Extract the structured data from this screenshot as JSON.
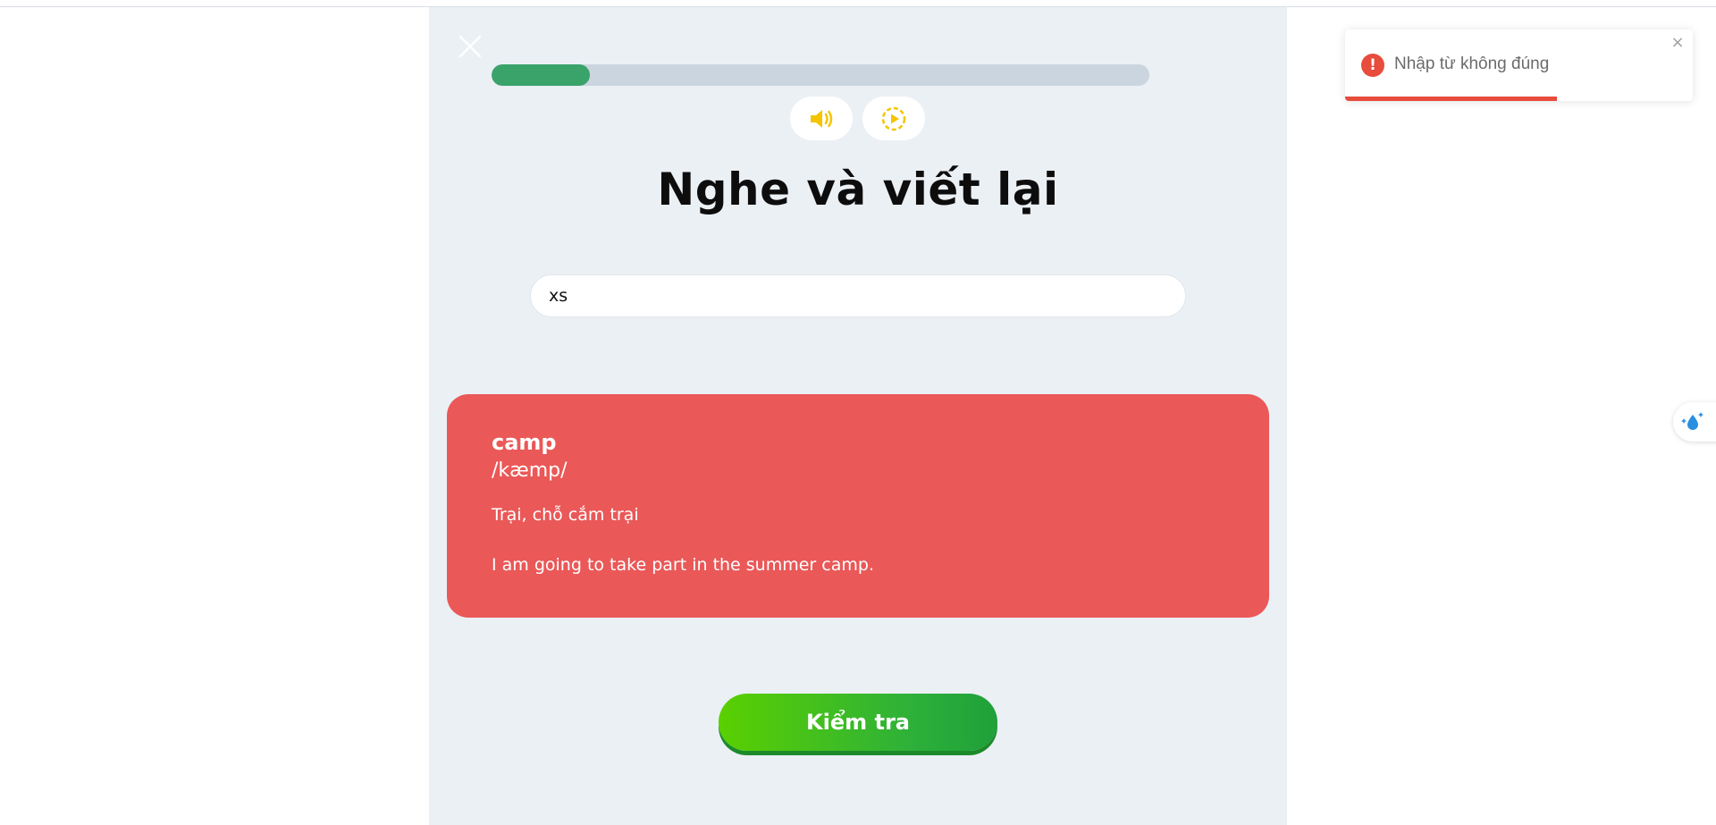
{
  "exercise": {
    "title": "Nghe và viết lại",
    "progress": 0.15,
    "answer_value": "xs"
  },
  "feedback": {
    "word": "camp",
    "ipa": "/kæmp/",
    "meaning": "Trại, chỗ cắm trại",
    "example": "I am going to take part in the summer camp.",
    "status_color": "#ea5858"
  },
  "actions": {
    "check_label": "Kiểm tra"
  },
  "toast": {
    "message": "Nhập từ không đúng",
    "icon": "!",
    "close": "×",
    "remaining": 0.61
  },
  "colors": {
    "accent_green": "#3aa36a",
    "button_green": "#2db03a",
    "error_red": "#e74c3c",
    "audio_icon": "#f5c400"
  },
  "icons": {
    "close": "close-icon",
    "speaker": "speaker-icon",
    "slow_play": "slow-play-icon",
    "side_widget": "sparkle-drop-icon"
  }
}
